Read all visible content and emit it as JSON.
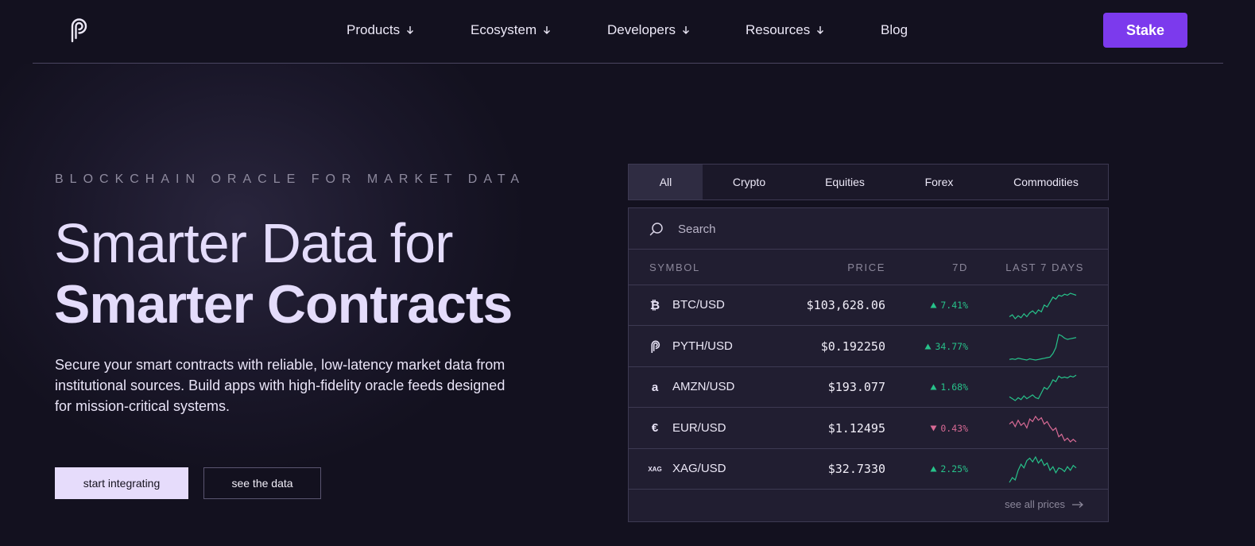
{
  "nav": {
    "items": [
      {
        "label": "Products",
        "dropdown": true
      },
      {
        "label": "Ecosystem",
        "dropdown": true
      },
      {
        "label": "Developers",
        "dropdown": true
      },
      {
        "label": "Resources",
        "dropdown": true
      },
      {
        "label": "Blog",
        "dropdown": false
      }
    ],
    "cta": "Stake"
  },
  "hero": {
    "eyebrow": "BLOCKCHAIN ORACLE FOR MARKET DATA",
    "title_line1": "Smarter Data for",
    "title_line2": "Smarter Contracts",
    "lead": "Secure your smart contracts with reliable, low-latency market data from institutional sources. Build apps with high-fidelity oracle feeds designed for mission-critical systems.",
    "primary_button": "start integrating",
    "secondary_button": "see the data"
  },
  "prices": {
    "tabs": [
      "All",
      "Crypto",
      "Equities",
      "Forex",
      "Commodities"
    ],
    "active_tab": "All",
    "search_placeholder": "Search",
    "columns": {
      "symbol": "SYMBOL",
      "price": "PRICE",
      "change": "7D",
      "trend": "LAST 7 DAYS"
    },
    "rows": [
      {
        "icon": "bitcoin-icon",
        "glyph": "₿",
        "symbol": "BTC/USD",
        "price": "$103,628.06",
        "change": "7.41%",
        "direction": "up",
        "trend": [
          40,
          42,
          38,
          41,
          39,
          43,
          40,
          44,
          46,
          43,
          47,
          45,
          52,
          50,
          55,
          60,
          58,
          62,
          61,
          63,
          62,
          64,
          63,
          62
        ]
      },
      {
        "icon": "pyth-icon",
        "glyph": "",
        "symbol": "PYTH/USD",
        "price": "$0.192250",
        "change": "34.77%",
        "direction": "up",
        "trend": [
          30,
          31,
          30,
          32,
          31,
          30,
          29,
          31,
          30,
          29,
          30,
          31,
          32,
          33,
          34,
          40,
          50,
          72,
          70,
          66,
          64,
          65,
          66,
          67
        ]
      },
      {
        "icon": "amazon-icon",
        "glyph": "a",
        "symbol": "AMZN/USD",
        "price": "$193.077",
        "change": "1.68%",
        "direction": "up",
        "trend": [
          40,
          38,
          36,
          39,
          37,
          41,
          38,
          40,
          42,
          39,
          38,
          44,
          50,
          48,
          52,
          58,
          56,
          62,
          60,
          61,
          60,
          62,
          61,
          63
        ]
      },
      {
        "icon": "euro-icon",
        "glyph": "€",
        "symbol": "EUR/USD",
        "price": "$1.12495",
        "change": "0.43%",
        "direction": "down",
        "trend": [
          60,
          62,
          58,
          63,
          59,
          61,
          57,
          64,
          62,
          66,
          63,
          65,
          60,
          62,
          58,
          55,
          57,
          50,
          52,
          47,
          49,
          46,
          48,
          46
        ]
      },
      {
        "icon": "xag-icon",
        "glyph": "XAG",
        "symbol": "XAG/USD",
        "price": "$32.7330",
        "change": "2.25%",
        "direction": "up",
        "trend": [
          30,
          34,
          32,
          40,
          45,
          42,
          48,
          50,
          47,
          51,
          46,
          49,
          44,
          46,
          40,
          43,
          38,
          42,
          41,
          39,
          43,
          40,
          44,
          42
        ]
      }
    ],
    "see_all": "see all prices"
  },
  "colors": {
    "accent": "#7c3aed",
    "up": "#27c28a",
    "down": "#d86a95",
    "background": "#13111f"
  }
}
